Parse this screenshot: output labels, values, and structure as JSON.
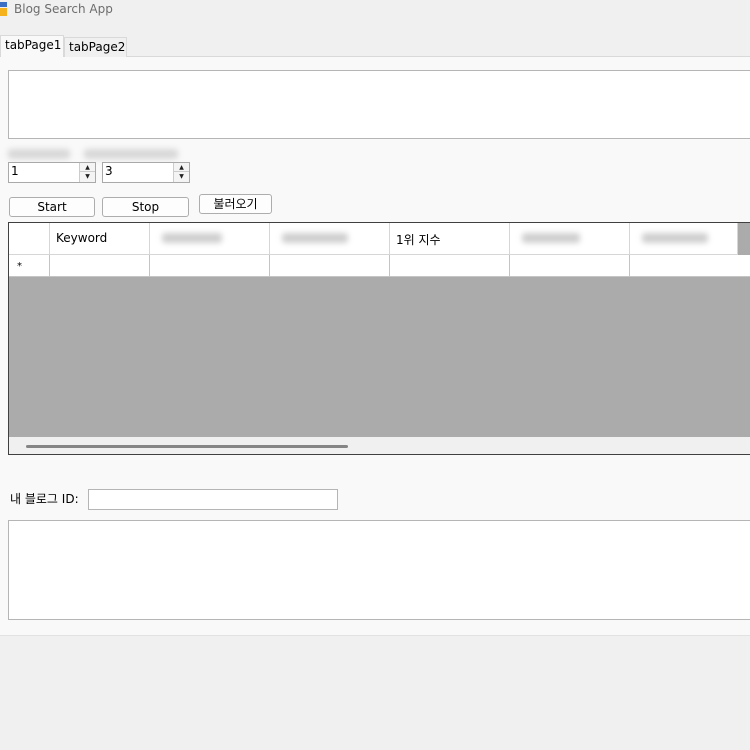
{
  "window": {
    "title": "Blog Search App"
  },
  "tabs": [
    {
      "label": "tabPage1",
      "selected": true
    },
    {
      "label": "tabPage2",
      "selected": false
    }
  ],
  "inputs": {
    "start_number": "1",
    "end_number": "3"
  },
  "buttons": {
    "start": "Start",
    "stop": "Stop",
    "load": "불러오기"
  },
  "grid": {
    "columns": [
      "Keyword",
      "",
      "",
      "1위 지수",
      "",
      ""
    ],
    "new_row_marker": "*"
  },
  "blog_id": {
    "label": "내 블로그 ID:",
    "value": ""
  },
  "colors": {
    "grid_background": "#ababab",
    "panel_background": "#f9f9f9",
    "window_background": "#f0f0f0"
  }
}
